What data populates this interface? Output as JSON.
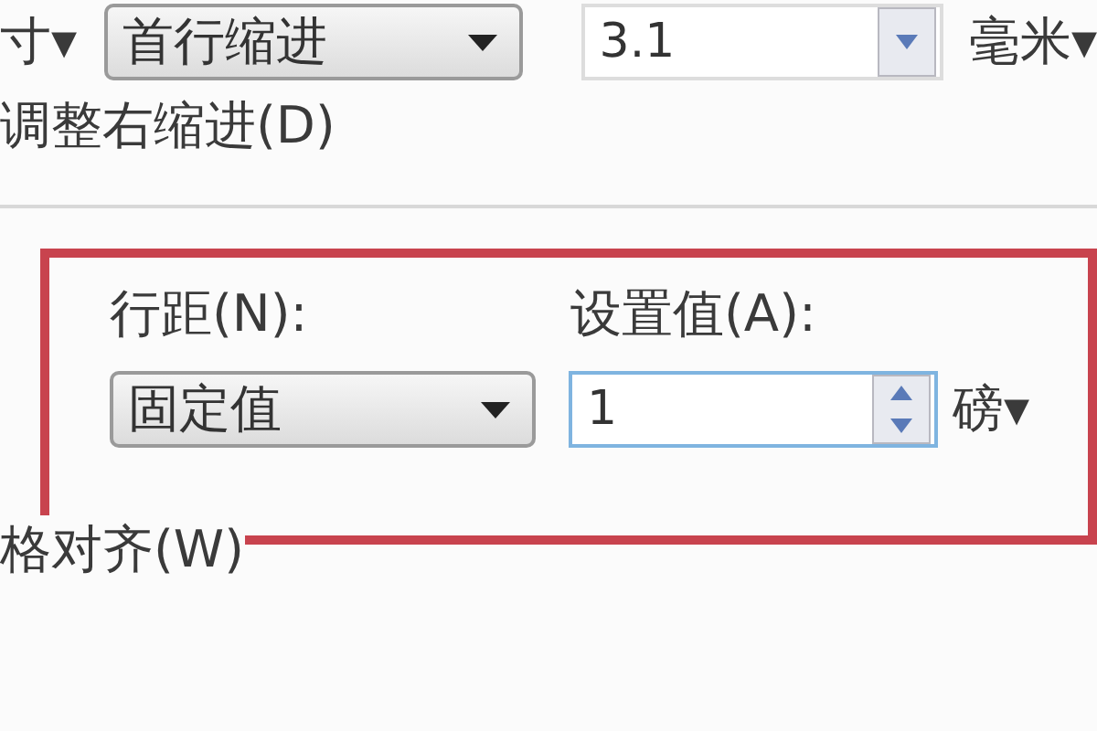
{
  "indentation": {
    "cut_label": "寸▾",
    "special": {
      "value": "首行缩进"
    },
    "by": {
      "value": "3.1",
      "focused": false
    },
    "unit": "毫米▾"
  },
  "auto_adjust_option": "调整右缩进(D)",
  "spacing": {
    "highlighted": true,
    "line_spacing_label": "行距(N):",
    "at_label": "设置值(A):",
    "line_spacing": {
      "value": "固定值"
    },
    "at": {
      "value": "1",
      "focused": true
    },
    "unit": "磅▾"
  },
  "snap_option": "格对齐(W)"
}
